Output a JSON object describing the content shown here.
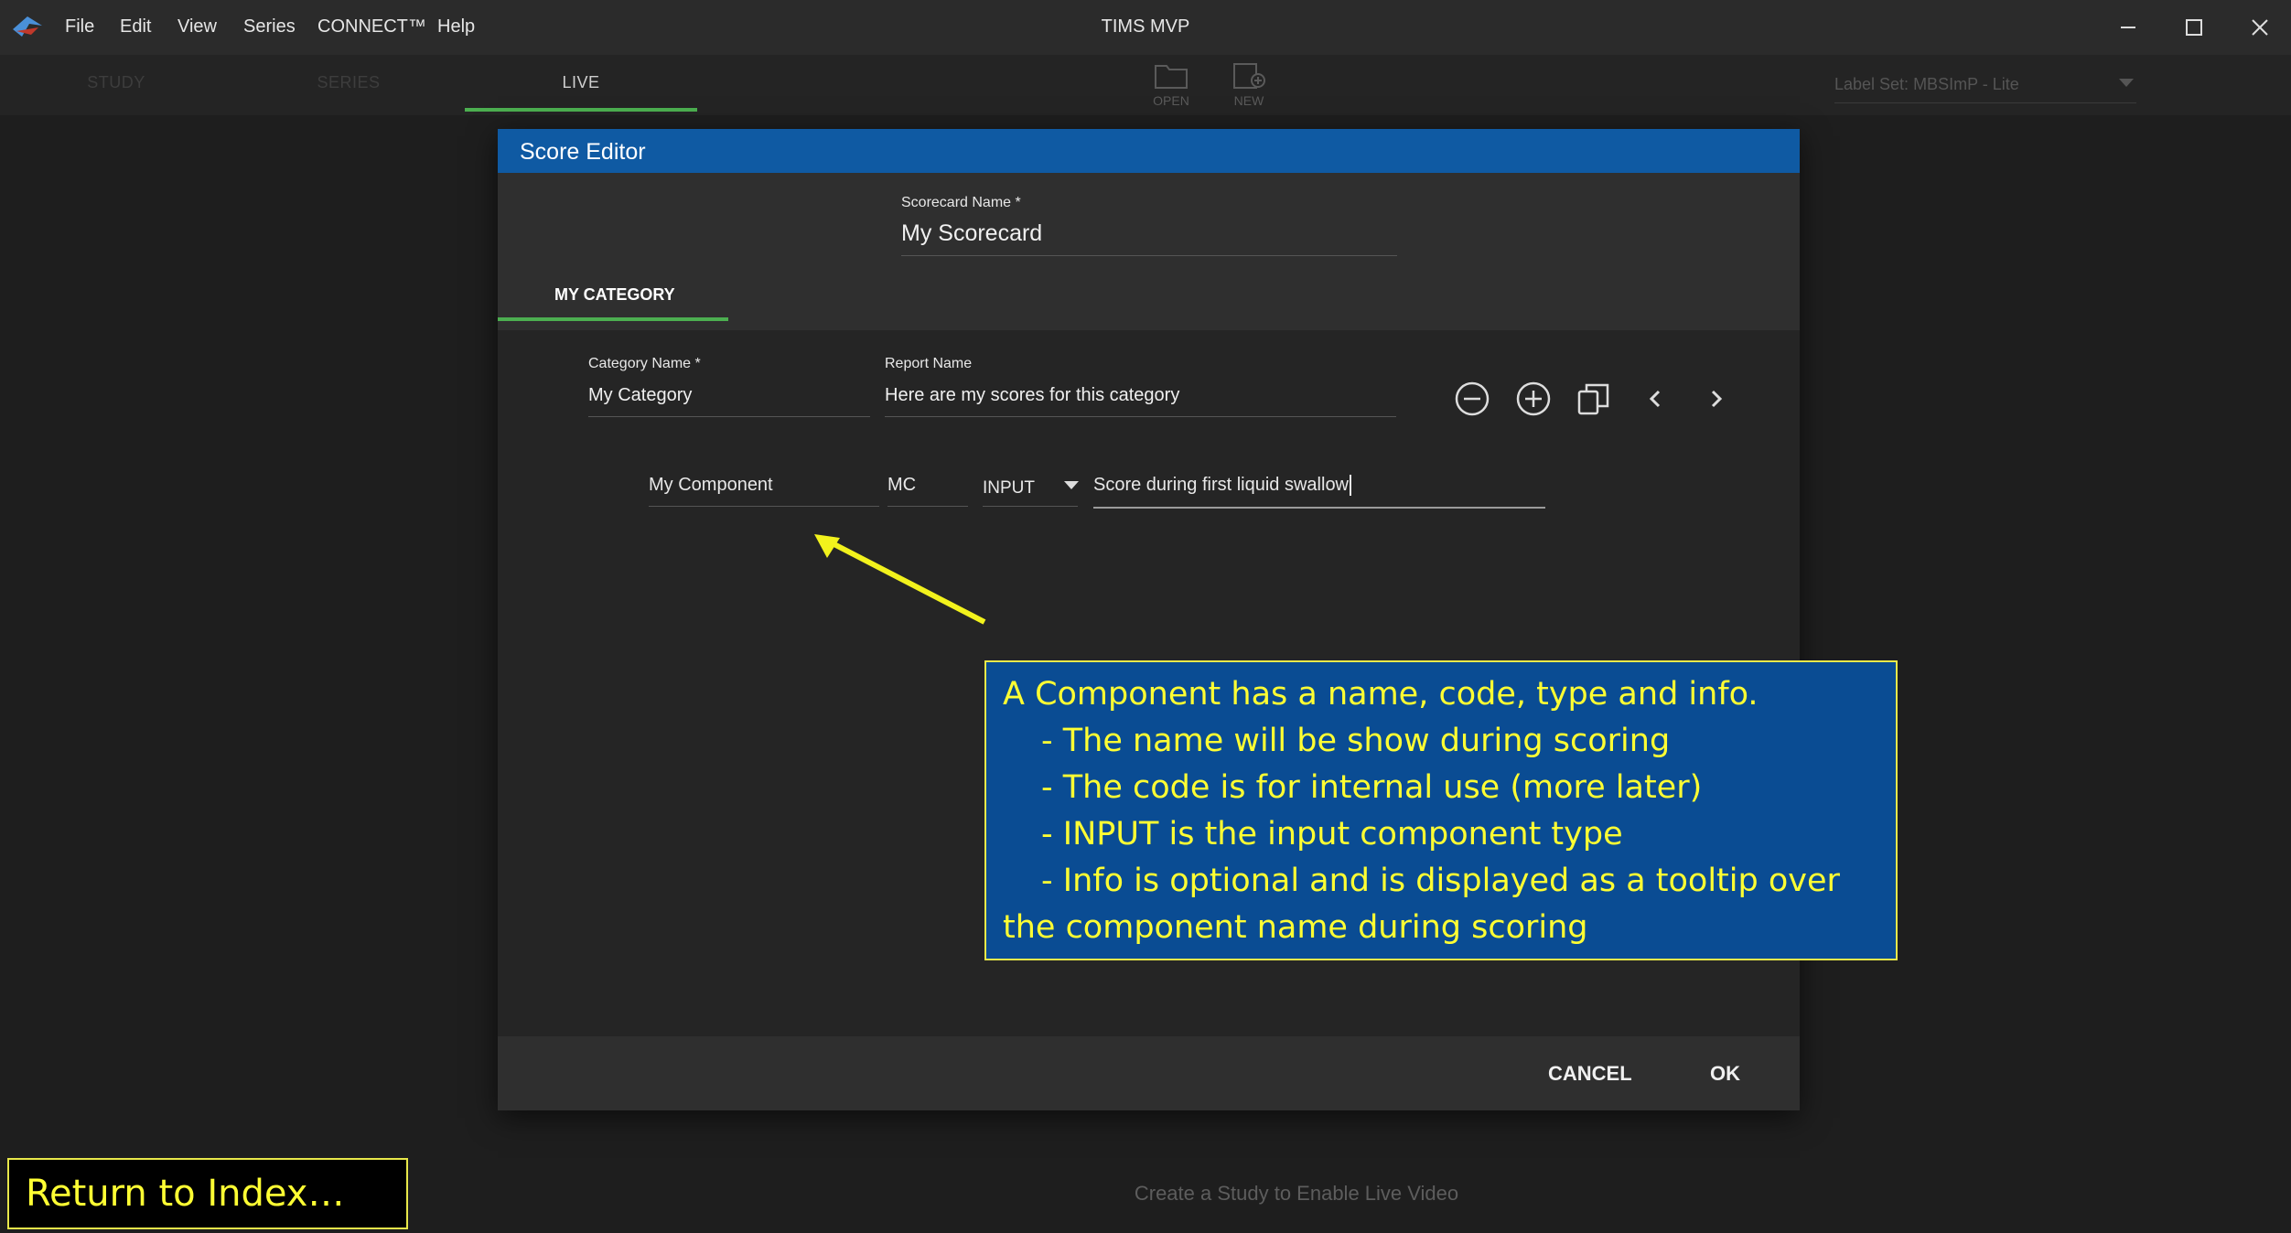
{
  "app": {
    "title": "TIMS MVP",
    "menu": [
      "File",
      "Edit",
      "View",
      "Series",
      "CONNECT™",
      "Help"
    ]
  },
  "toolbar": {
    "tabs": [
      "STUDY",
      "SERIES",
      "LIVE"
    ],
    "active_tab": "LIVE",
    "open_label": "OPEN",
    "new_label": "NEW",
    "label_set": "Label Set: MBSImP - Lite"
  },
  "dialog": {
    "title": "Score Editor",
    "scorecard_name_label": "Scorecard Name *",
    "scorecard_name_value": "My Scorecard",
    "category_tab": "MY CATEGORY",
    "category_name_label": "Category Name *",
    "category_name_value": "My Category",
    "report_name_label": "Report Name",
    "report_name_value": "Here are my scores for this category",
    "component": {
      "name": "My Component",
      "code": "MC",
      "type": "INPUT",
      "info": "Score during first liquid swallow"
    },
    "cancel_label": "CANCEL",
    "ok_label": "OK"
  },
  "annotation": {
    "lines": [
      "A Component has a name, code, type and info.",
      "- The name will be show during scoring",
      "- The code is for internal use (more later)",
      "- INPUT is the input component type",
      "- Info is optional and is displayed as a tooltip over",
      "the component name during scoring"
    ],
    "accent_color": "#ffff33",
    "box_color": "#0a4c93"
  },
  "footer": {
    "return_link": "Return to Index…",
    "live_message": "Create a Study to Enable Live Video"
  },
  "icons": [
    "app-logo-icon",
    "minimize-icon",
    "maximize-icon",
    "close-icon",
    "folder-open-icon",
    "new-study-icon",
    "remove-circle-icon",
    "add-circle-icon",
    "copy-icon",
    "chevron-left-icon",
    "chevron-right-icon",
    "dropdown-arrow-icon",
    "pointer-arrow-icon"
  ]
}
